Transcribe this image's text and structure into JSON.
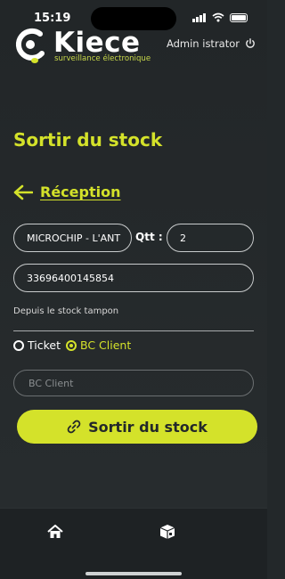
{
  "status": {
    "time": "15:19"
  },
  "header": {
    "brand": "Kiece",
    "tagline": "surveillance électronique",
    "user": "Admin istrator"
  },
  "page": {
    "title": "Sortir du stock",
    "back_label": "Réception"
  },
  "form": {
    "product": "MICROCHIP - L'ANT",
    "qtt_label": "Qtt :",
    "qtt_value": "2",
    "barcode": "33696400145854",
    "source_label": "Depuis le stock tampon",
    "radio_ticket": "Ticket",
    "radio_bc": "BC Client",
    "selected": "BC Client",
    "bc_placeholder": "BC Client",
    "bc_value": ""
  },
  "action": {
    "label": "Sortir du stock"
  },
  "colors": {
    "accent": "#d4e22a",
    "background": "#23282a"
  },
  "icons": [
    "wifi-icon",
    "battery-icon",
    "power-icon",
    "arrow-left-icon",
    "link-icon",
    "home-icon",
    "box-icon"
  ]
}
